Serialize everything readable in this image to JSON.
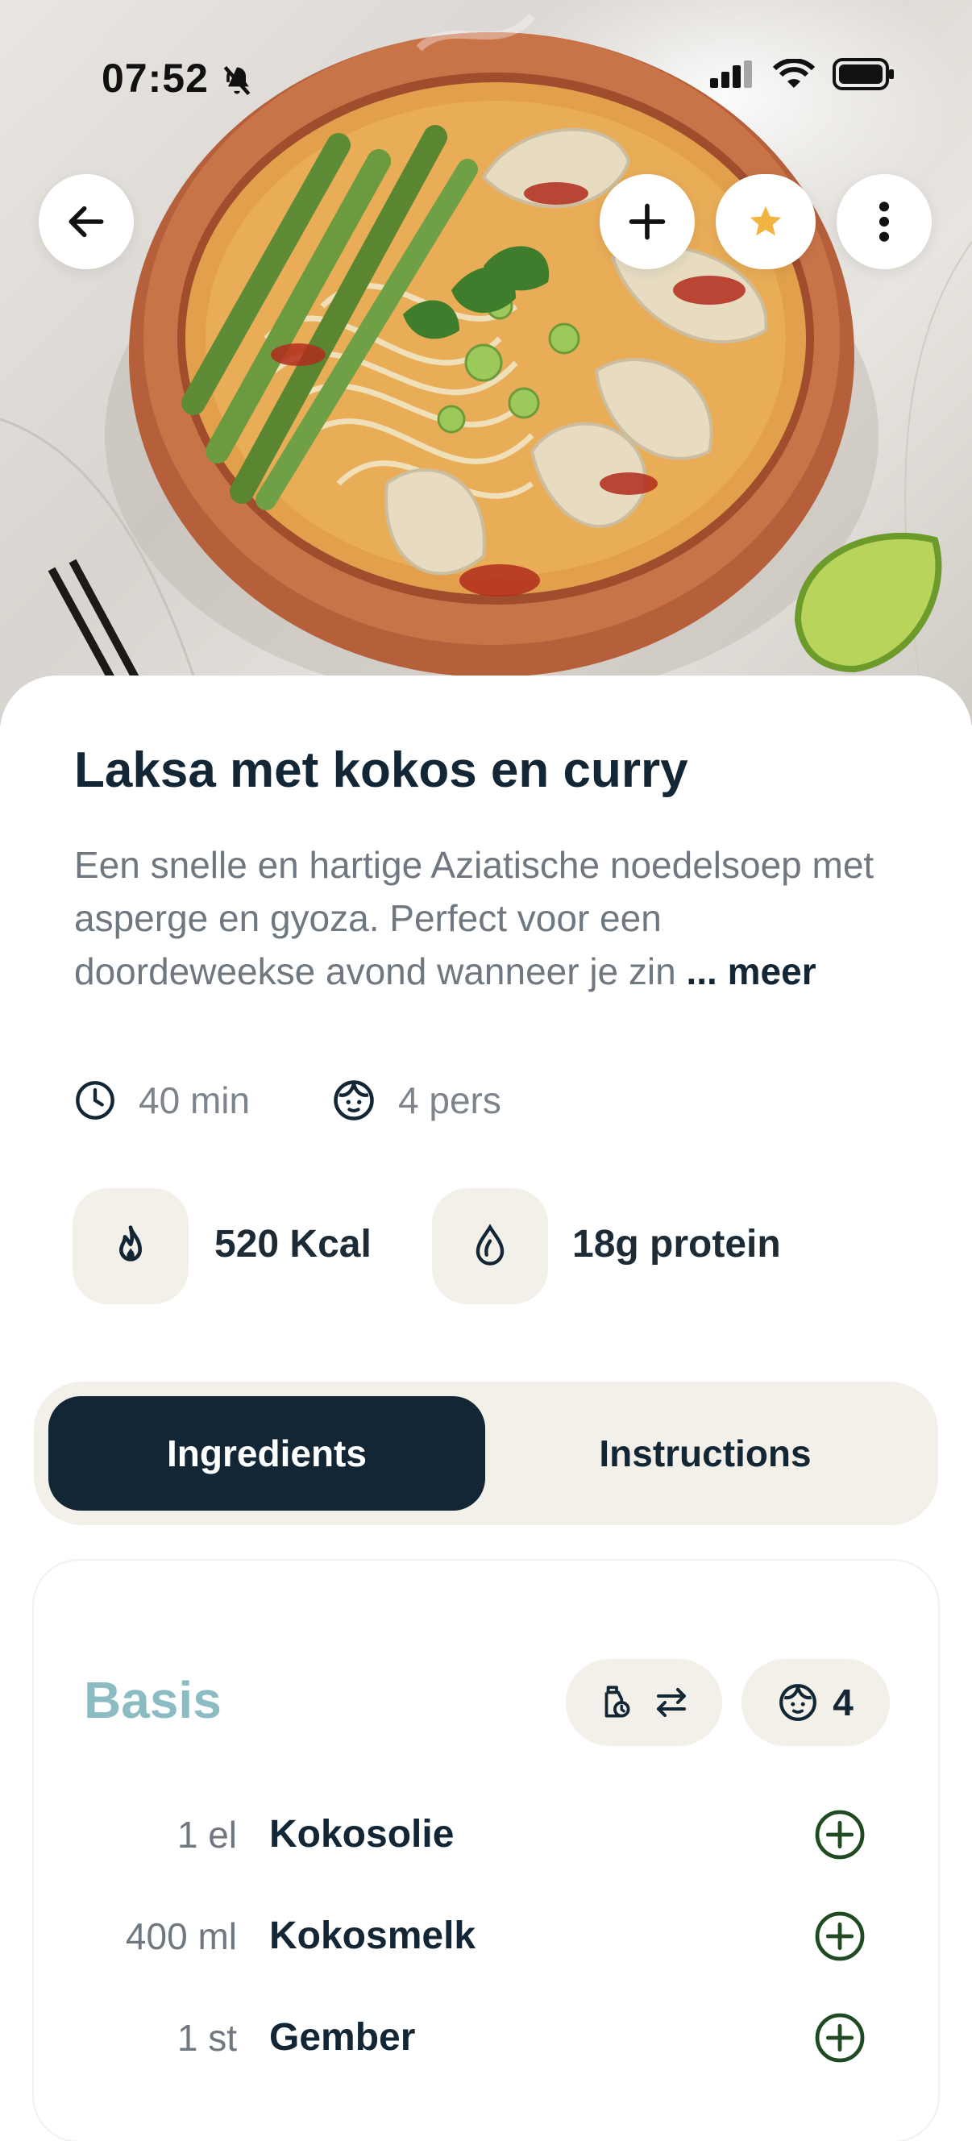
{
  "status_bar": {
    "time": "07:52",
    "icons": [
      "bell-slash-icon",
      "signal-icon",
      "wifi-icon",
      "battery-icon"
    ]
  },
  "header_buttons": {
    "back": "arrow-left-icon",
    "add": "plus-icon",
    "favorite": "star-icon",
    "more": "more-vertical-icon"
  },
  "recipe": {
    "title": "Laksa met kokos en curry",
    "description": "Een snelle en hartige Aziatische noedelsoep met asperge en gyoza. Perfect voor een doordeweekse avond wanneer je zin",
    "more_label": "... meer",
    "time": "40 min",
    "servings": "4 pers",
    "calories": "520 Kcal",
    "protein": "18g protein"
  },
  "tabs": {
    "ingredients": "Ingredients",
    "instructions": "Instructions",
    "active": "ingredients"
  },
  "ingredients": {
    "section_title": "Basis",
    "servings_count": "4",
    "items": [
      {
        "qty": "1 el",
        "name": "Kokosolie"
      },
      {
        "qty": "400 ml",
        "name": "Kokosmelk"
      },
      {
        "qty": "1 st",
        "name": "Gember"
      }
    ]
  },
  "colors": {
    "navy": "#132635",
    "beige": "#f3f0e9",
    "accent_teal": "#8bbcc4",
    "star": "#f2b441",
    "add_icon_green": "#1f4a22"
  }
}
